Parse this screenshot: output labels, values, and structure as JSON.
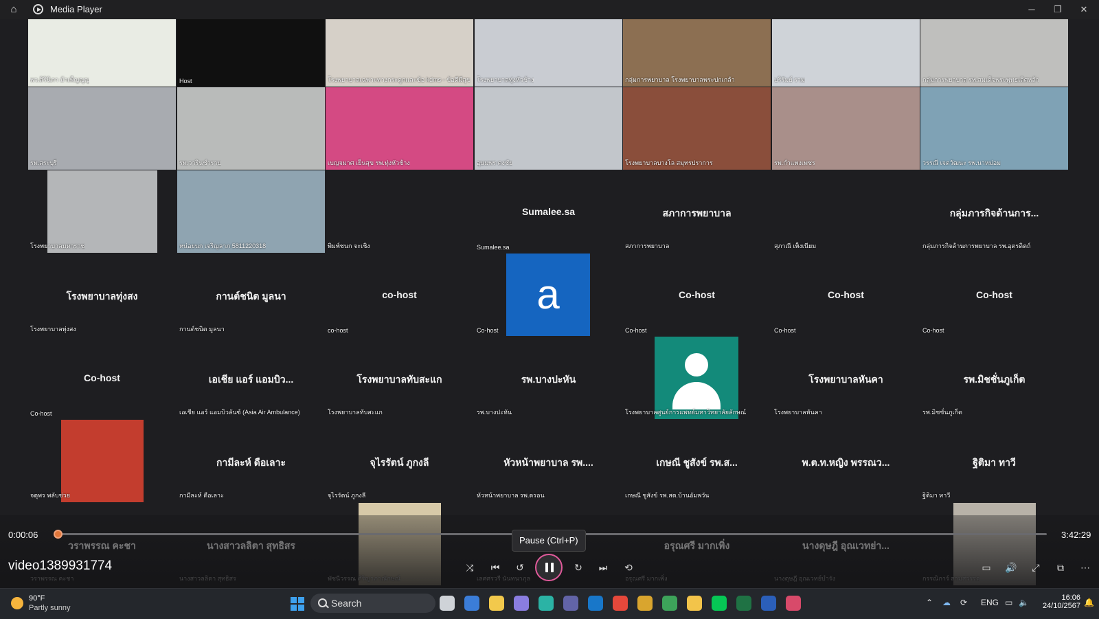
{
  "window": {
    "title": "Media Player",
    "home_icon": "home-icon",
    "app_icon": "media-player-icon",
    "controls": [
      "minimize-icon",
      "restore-icon",
      "close-icon"
    ]
  },
  "tiles": [
    {
      "caption": "พว.สิรินิภา ม้าเพ็ญญูญ",
      "display_name": "",
      "bg": "#e9ece4"
    },
    {
      "caption": "Host",
      "display_name": "",
      "bg": "#101010"
    },
    {
      "caption": "โรงพยาบาลเฉพาะทางกระดูกและข้อ kdms - ข้อดีมีสุข",
      "display_name": "",
      "bg": "#d6d0c8"
    },
    {
      "caption": "โรงพยาบาลทุ่งหัวช้าง",
      "display_name": "",
      "bg": "#c9ccd2"
    },
    {
      "caption": "กลุ่มการพยาบาล โรงพยาบาลพระปกเกล้า",
      "display_name": "",
      "bg": "#8c6f52"
    },
    {
      "caption": "บริรัมย์ ราม",
      "display_name": "",
      "bg": "#cfd3d8"
    },
    {
      "caption": "กลุ่มการพยาบาล รพ.สมเด็จพระพุทธเลิศหล้า",
      "display_name": "",
      "bg": "#bfbfbd"
    },
    {
      "caption": "รพ.สระบุรี",
      "display_name": "",
      "bg": "#a8abb0"
    },
    {
      "caption": "รพ.วารินชำราบ",
      "display_name": "",
      "bg": "#b9bbba"
    },
    {
      "caption": "เบญจมาศ เย็นสุข รพ.ทุ่งหัวช้าง",
      "display_name": "",
      "bg": "#d44a83"
    },
    {
      "caption": "อุษมพร คงชัย",
      "display_name": "",
      "bg": "#c2c6cb"
    },
    {
      "caption": "โรงพยาบาลบางโล สมุทรปราการ",
      "display_name": "",
      "bg": "#8a4e3b"
    },
    {
      "caption": "รพ.กำแพงเพชร",
      "display_name": "",
      "bg": "#a98f8a"
    },
    {
      "caption": "วรรณี เจตวัฒนะ รพ.นาหม่อม",
      "display_name": "",
      "bg": "#7fa2b5"
    },
    {
      "caption": "โรงพยาบาลมหาราช",
      "display_name": "",
      "bg": "#b4b6b8"
    },
    {
      "caption": "หน่อยนก เจริญลาภ 5811220318",
      "display_name": "",
      "bg": "#8fa4b1"
    },
    {
      "caption": "พิมพ์ชนก จะเชิง",
      "display_name": "",
      "bg": "#1e1e21"
    },
    {
      "caption": "Sumalee.sa",
      "display_name": "Sumalee.sa",
      "bg": ""
    },
    {
      "caption": "สภาการพยาบาล",
      "display_name": "สภาการพยาบาล",
      "bg": ""
    },
    {
      "caption": "สุภาณี เพ็งเนียม",
      "display_name": "",
      "bg": "#1e1e21"
    },
    {
      "caption": "กลุ่มภารกิจด้านการพยาบาล รพ.อุตรดิตถ์",
      "display_name": "กลุ่มภารกิจด้านการ...",
      "bg": ""
    },
    {
      "caption": "โรงพยาบาลทุ่งสง",
      "display_name": "โรงพยาบาลทุ่งสง",
      "bg": ""
    },
    {
      "caption": "กานต์ชนิต มูลนา",
      "display_name": "กานต์ชนิต มูลนา",
      "bg": ""
    },
    {
      "caption": "co-host",
      "display_name": "co-host",
      "bg": ""
    },
    {
      "caption": "Co-host",
      "display_name": "",
      "bg": ""
    },
    {
      "caption": "Co-host",
      "display_name": "Co-host",
      "bg": ""
    },
    {
      "caption": "Co-host",
      "display_name": "Co-host",
      "bg": ""
    },
    {
      "caption": "Co-host",
      "display_name": "Co-host",
      "bg": ""
    },
    {
      "caption": "Co-host",
      "display_name": "Co-host",
      "bg": ""
    },
    {
      "caption": "เอเชีย แอร์ แอมบิวลันซ์ (Asia Air Ambulance)",
      "display_name": "เอเชีย แอร์ แอมบิว...",
      "bg": ""
    },
    {
      "caption": "โรงพยาบาลทับสะแก",
      "display_name": "โรงพยาบาลทับสะแก",
      "bg": ""
    },
    {
      "caption": "รพ.บางปะหัน",
      "display_name": "รพ.บางปะหัน",
      "bg": ""
    },
    {
      "caption": "โรงพยาบาลศูนย์การแพทย์มหาวิทยาลัยลักษณ์",
      "display_name": "",
      "bg": ""
    },
    {
      "caption": "โรงพยาบาลหันคา",
      "display_name": "โรงพยาบาลหันคา",
      "bg": ""
    },
    {
      "caption": "รพ.มิชชั่นภูเก็ต",
      "display_name": "รพ.มิชชั่นภูเก็ต",
      "bg": ""
    },
    {
      "caption": "จตุพร พลับช่วย",
      "display_name": "",
      "bg": ""
    },
    {
      "caption": "กามีละห์ ดือเลาะ",
      "display_name": "กามีละห์ ดือเลาะ",
      "bg": ""
    },
    {
      "caption": "จุไรรัตน์ ภูกงลี",
      "display_name": "จุไรรัตน์ ภูกงลี",
      "bg": ""
    },
    {
      "caption": "หัวหน้าพยาบาล รพ.ตรอน",
      "display_name": "หัวหน้าพยาบาล รพ....",
      "bg": ""
    },
    {
      "caption": "เกษณี ชูสังข์ รพ.สต.บ้านอัมพวัน",
      "display_name": "เกษณี ชูสังข์ รพ.ส...",
      "bg": ""
    },
    {
      "caption": "",
      "display_name": "พ.ต.ท.หญิง พรรณว...",
      "bg": ""
    },
    {
      "caption": "ฐิติมา ทาวี",
      "display_name": "ฐิติมา ทาวี",
      "bg": ""
    },
    {
      "caption": "วราพรรณ คะชา",
      "display_name": "วราพรรณ คะชา",
      "bg": ""
    },
    {
      "caption": "นางสาวลลิตา สุทธิสร",
      "display_name": "นางสาวลลิตา สุทธิสร",
      "bg": ""
    },
    {
      "caption": "พัชนีวรรณ ศิริญาภาณักษณ์",
      "display_name": "",
      "bg": ""
    },
    {
      "caption": "เลศศรวรี นันทนาภุล",
      "display_name": "",
      "bg": ""
    },
    {
      "caption": "อรุณศรี มากเพิ่ง",
      "display_name": "อรุณศรี มากเพิ่ง",
      "bg": ""
    },
    {
      "caption": "นางดุษฎี อุณเวทย์บำรัง",
      "display_name": "นางดุษฎี อุณเวทย่า...",
      "bg": ""
    },
    {
      "caption": "กรรณิการ์ สามสวรรค",
      "display_name": "",
      "bg": ""
    }
  ],
  "avatar_letter": "a",
  "player": {
    "current_time": "0:00:06",
    "duration": "3:42:29",
    "progress": 0.0005,
    "video_title": "video1389931774",
    "tooltip": "Pause (Ctrl+P)",
    "controls": [
      "shuffle-icon",
      "previous-icon",
      "rewind-10-icon",
      "pause-icon",
      "forward-30-icon",
      "next-icon",
      "repeat-icon"
    ],
    "right_controls": [
      "captions-icon",
      "volume-icon",
      "fullscreen-icon",
      "miniplayer-icon",
      "more-icon"
    ]
  },
  "taskbar": {
    "temp": "90°F",
    "condition": "Partly sunny",
    "search_placeholder": "Search",
    "lang": "ENG",
    "time": "16:06",
    "date": "24/10/2567",
    "apps": [
      {
        "name": "task-view",
        "color": "#cfd3d8"
      },
      {
        "name": "store",
        "color": "#3b7dd8"
      },
      {
        "name": "sticky-notes",
        "color": "#f2c94c"
      },
      {
        "name": "copilot",
        "color": "#8a7de0"
      },
      {
        "name": "edge",
        "color": "#2bb3a5"
      },
      {
        "name": "teams",
        "color": "#6264a7"
      },
      {
        "name": "outlook",
        "color": "#1877c9"
      },
      {
        "name": "chrome",
        "color": "#e5483b"
      },
      {
        "name": "chrome-2",
        "color": "#d9a52e"
      },
      {
        "name": "chrome-3",
        "color": "#3da35a"
      },
      {
        "name": "file-explorer",
        "color": "#f3c44a"
      },
      {
        "name": "line",
        "color": "#06c755"
      },
      {
        "name": "excel",
        "color": "#1f7244"
      },
      {
        "name": "word",
        "color": "#2b5fb9"
      },
      {
        "name": "media-player",
        "color": "#d84a6a"
      }
    ]
  }
}
